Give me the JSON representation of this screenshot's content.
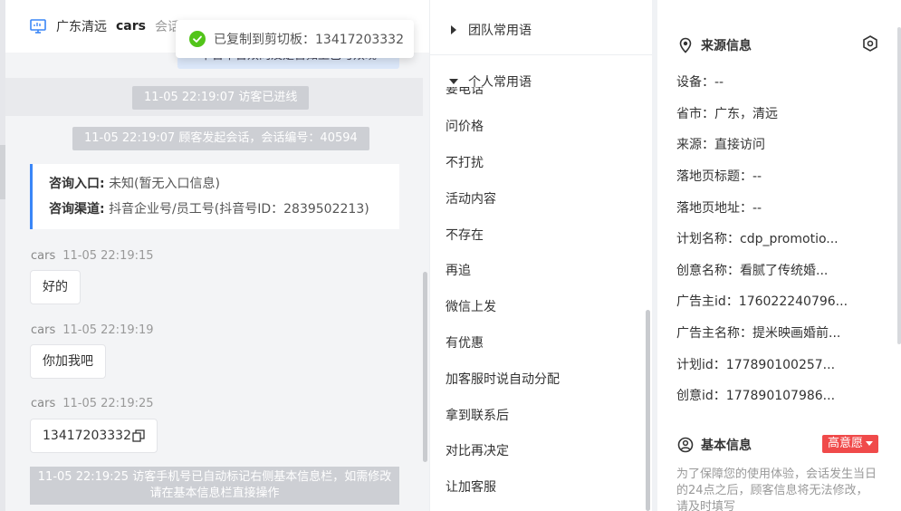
{
  "chat": {
    "header": {
      "region": "广东清远",
      "name": "cars",
      "session_label": "会话"
    },
    "partial_bubble_text": "下台平台双向及是否如上已与双现",
    "system_messages": [
      "11-05 22:19:07 访客已进线",
      "11-05 22:19:07 顾客发起会话，会话编号：40594"
    ],
    "entry_card": {
      "entry_label": "咨询入口:",
      "entry_value": "未知(暂无入口信息)",
      "channel_label": "咨询渠道:",
      "channel_value": "抖音企业号/员工号(抖音号ID：2839502213)"
    },
    "messages": [
      {
        "sender": "cars",
        "time": "11-05 22:19:15",
        "text": "好的"
      },
      {
        "sender": "cars",
        "time": "11-05 22:19:19",
        "text": "你加我吧"
      },
      {
        "sender": "cars",
        "time": "11-05 22:19:25",
        "text": "13417203332"
      }
    ],
    "final_system_message": "11-05 22:19:25 访客手机号已自动标记右侧基本信息栏，如需修改请在基本信息栏直接操作"
  },
  "toast": {
    "text": "已复制到剪切板：13417203332",
    "icon": "check-circle-icon",
    "color": "#52c41a"
  },
  "phrases": {
    "team_group_label": "团队常用语",
    "personal_group_label": "个人常用语",
    "cut_item": "要电话",
    "items": [
      "问价格",
      "不打扰",
      "活动内容",
      "不存在",
      "再追",
      "微信上发",
      "有优惠",
      "加客服时说自动分配",
      "拿到联系后",
      "对比再决定",
      "让加客服"
    ]
  },
  "info": {
    "source_title": "来源信息",
    "source_rows": [
      {
        "label": "设备：",
        "value": "--"
      },
      {
        "label": "省市：",
        "value": "广东，清远"
      },
      {
        "label": "来源：",
        "value": "直接访问"
      },
      {
        "label": "落地页标题：",
        "value": "--"
      },
      {
        "label": "落地页地址：",
        "value": "--"
      },
      {
        "label": "计划名称：",
        "value": "cdp_promotio..."
      },
      {
        "label": "创意名称：",
        "value": "看腻了传统婚..."
      },
      {
        "label": "广告主id：",
        "value": "176022240796..."
      },
      {
        "label": "广告主名称：",
        "value": "提米映画婚前..."
      },
      {
        "label": "计划id：",
        "value": "177890100257..."
      },
      {
        "label": "创意id：",
        "value": "177890107986..."
      }
    ],
    "basic_title": "基本信息",
    "intent_badge": "高意愿",
    "notice": "为了保障您的使用体验，会话发生当日的24点之后，顾客信息将无法修改，请及时填写"
  },
  "colors": {
    "accent": "#3a86f7",
    "badge": "#f04a4a",
    "system_pill": "#cdcfd4"
  }
}
